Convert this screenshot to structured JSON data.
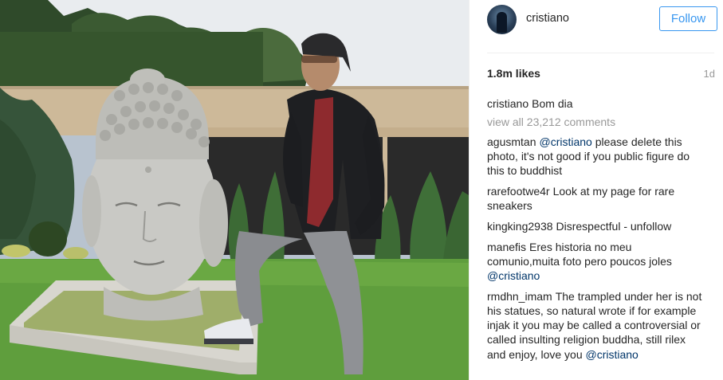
{
  "post": {
    "username": "cristiano",
    "follow_label": "Follow",
    "likes": "1.8m likes",
    "time": "1d",
    "caption": {
      "user": "cristiano",
      "text": "Bom dia"
    },
    "view_all": "view all 23,212 comments",
    "comments": [
      {
        "user": "agusmtan",
        "mention": "@cristiano",
        "text": " please delete this photo, it's not good if you public figure do this to buddhist"
      },
      {
        "user": "rarefootwe4r",
        "mention": "",
        "text": "Look at my page for rare sneakers"
      },
      {
        "user": "kingking2938",
        "mention": "",
        "text": "Disrespectful - unfollow"
      },
      {
        "user": "manefis",
        "mention": "@cristiano",
        "text": "Eres historia no meu comunio,muita foto pero poucos joles ",
        "mention_after": true
      },
      {
        "user": "rmdhn_imam",
        "mention": "@cristiano",
        "text": "The trampled under her is not his statues, so natural wrote if for example injak it you may be called a controversial or called insulting religion buddha, still rilex and enjoy, love you ",
        "mention_after": true
      }
    ]
  },
  "colors": {
    "follow_blue": "#3897f0",
    "mention_blue": "#003569",
    "muted_gray": "#999999",
    "text": "#262626"
  },
  "icons": {
    "avatar": "profile-avatar"
  }
}
